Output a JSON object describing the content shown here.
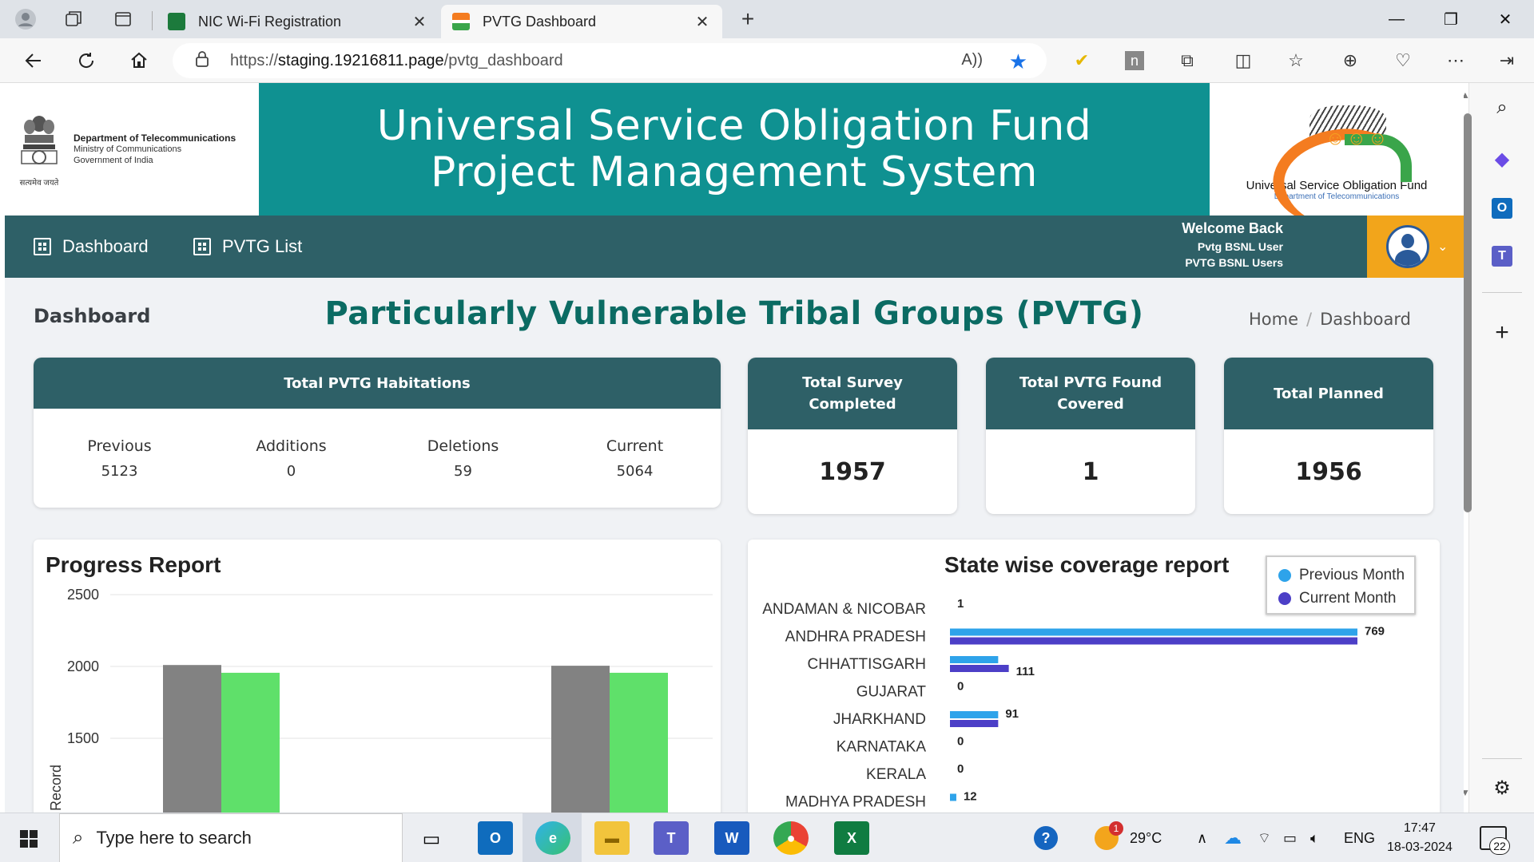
{
  "browser": {
    "tabs": [
      {
        "label": "NIC Wi-Fi Registration",
        "active": false
      },
      {
        "label": "PVTG Dashboard",
        "active": true
      }
    ],
    "url_prefix": "https://",
    "url_host": "staging.19216811.page",
    "url_path": "/pvtg_dashboard"
  },
  "header": {
    "dept_name": "Department of Telecommunications",
    "ministry": "Ministry of Communications",
    "government": "Government of India",
    "emblem_motto": "सत्यमेव जयते",
    "title_line1": "Universal Service Obligation Fund",
    "title_line2": "Project Management System",
    "logo_name": "Universal Service Obligation Fund",
    "logo_sub": "Department of Telecommunications"
  },
  "nav": {
    "items": [
      {
        "label": "Dashboard"
      },
      {
        "label": "PVTG List"
      }
    ],
    "welcome": "Welcome Back",
    "user_name": "Pvtg BSNL User",
    "user_group": "PVTG BSNL Users"
  },
  "page": {
    "heading": "Dashboard",
    "title": "Particularly Vulnerable Tribal Groups (PVTG)",
    "breadcrumb": [
      "Home",
      "Dashboard"
    ]
  },
  "habitations": {
    "title": "Total PVTG Habitations",
    "stats": [
      {
        "label": "Previous",
        "value": "5123"
      },
      {
        "label": "Additions",
        "value": "0"
      },
      {
        "label": "Deletions",
        "value": "59"
      },
      {
        "label": "Current",
        "value": "5064"
      }
    ]
  },
  "kpis": [
    {
      "title": "Total Survey Completed",
      "value": "1957"
    },
    {
      "title": "Total PVTG Found Covered",
      "value": "1"
    },
    {
      "title": "Total Planned",
      "value": "1956"
    }
  ],
  "chart_data": [
    {
      "type": "bar",
      "title": "Progress Report",
      "ylabel": "Record",
      "yticks": [
        2500,
        2000,
        1500
      ],
      "ylim": [
        1200,
        2500
      ],
      "series": [
        {
          "color": "#828282",
          "values": [
            2010,
            2005
          ]
        },
        {
          "color": "#5fe06a",
          "values": [
            1956,
            1956
          ]
        }
      ],
      "grid": true
    },
    {
      "type": "bar",
      "orientation": "horizontal",
      "title": "State wise coverage report",
      "legend_position": "top-right",
      "categories": [
        "ANDAMAN & NICOBAR",
        "ANDHRA PRADESH",
        "CHHATTISGARH",
        "GUJARAT",
        "JHARKHAND",
        "KARNATAKA",
        "KERALA",
        "MADHYA PRADESH"
      ],
      "series": [
        {
          "name": "Previous Month",
          "color": "#2ea3ea",
          "values": [
            0,
            769,
            91,
            0,
            91,
            0,
            0,
            12
          ]
        },
        {
          "name": "Current Month",
          "color": "#4c3fc7",
          "values": [
            0,
            769,
            111,
            0,
            91,
            0,
            0,
            0
          ]
        }
      ],
      "data_labels": [
        "1",
        "769",
        "111",
        "0",
        "91",
        "0",
        "0",
        "12"
      ],
      "xlim": [
        0,
        780
      ]
    }
  ],
  "taskbar": {
    "search_placeholder": "Type here to search",
    "temperature": "29°C",
    "weather_badge": "1",
    "language": "ENG",
    "time": "17:47",
    "date": "18-03-2024",
    "notifications": "22"
  },
  "colors": {
    "teal_header": "#0f9191",
    "nav": "#2e6067",
    "title_green": "#0b6b63",
    "user_orange": "#f2a51b"
  }
}
